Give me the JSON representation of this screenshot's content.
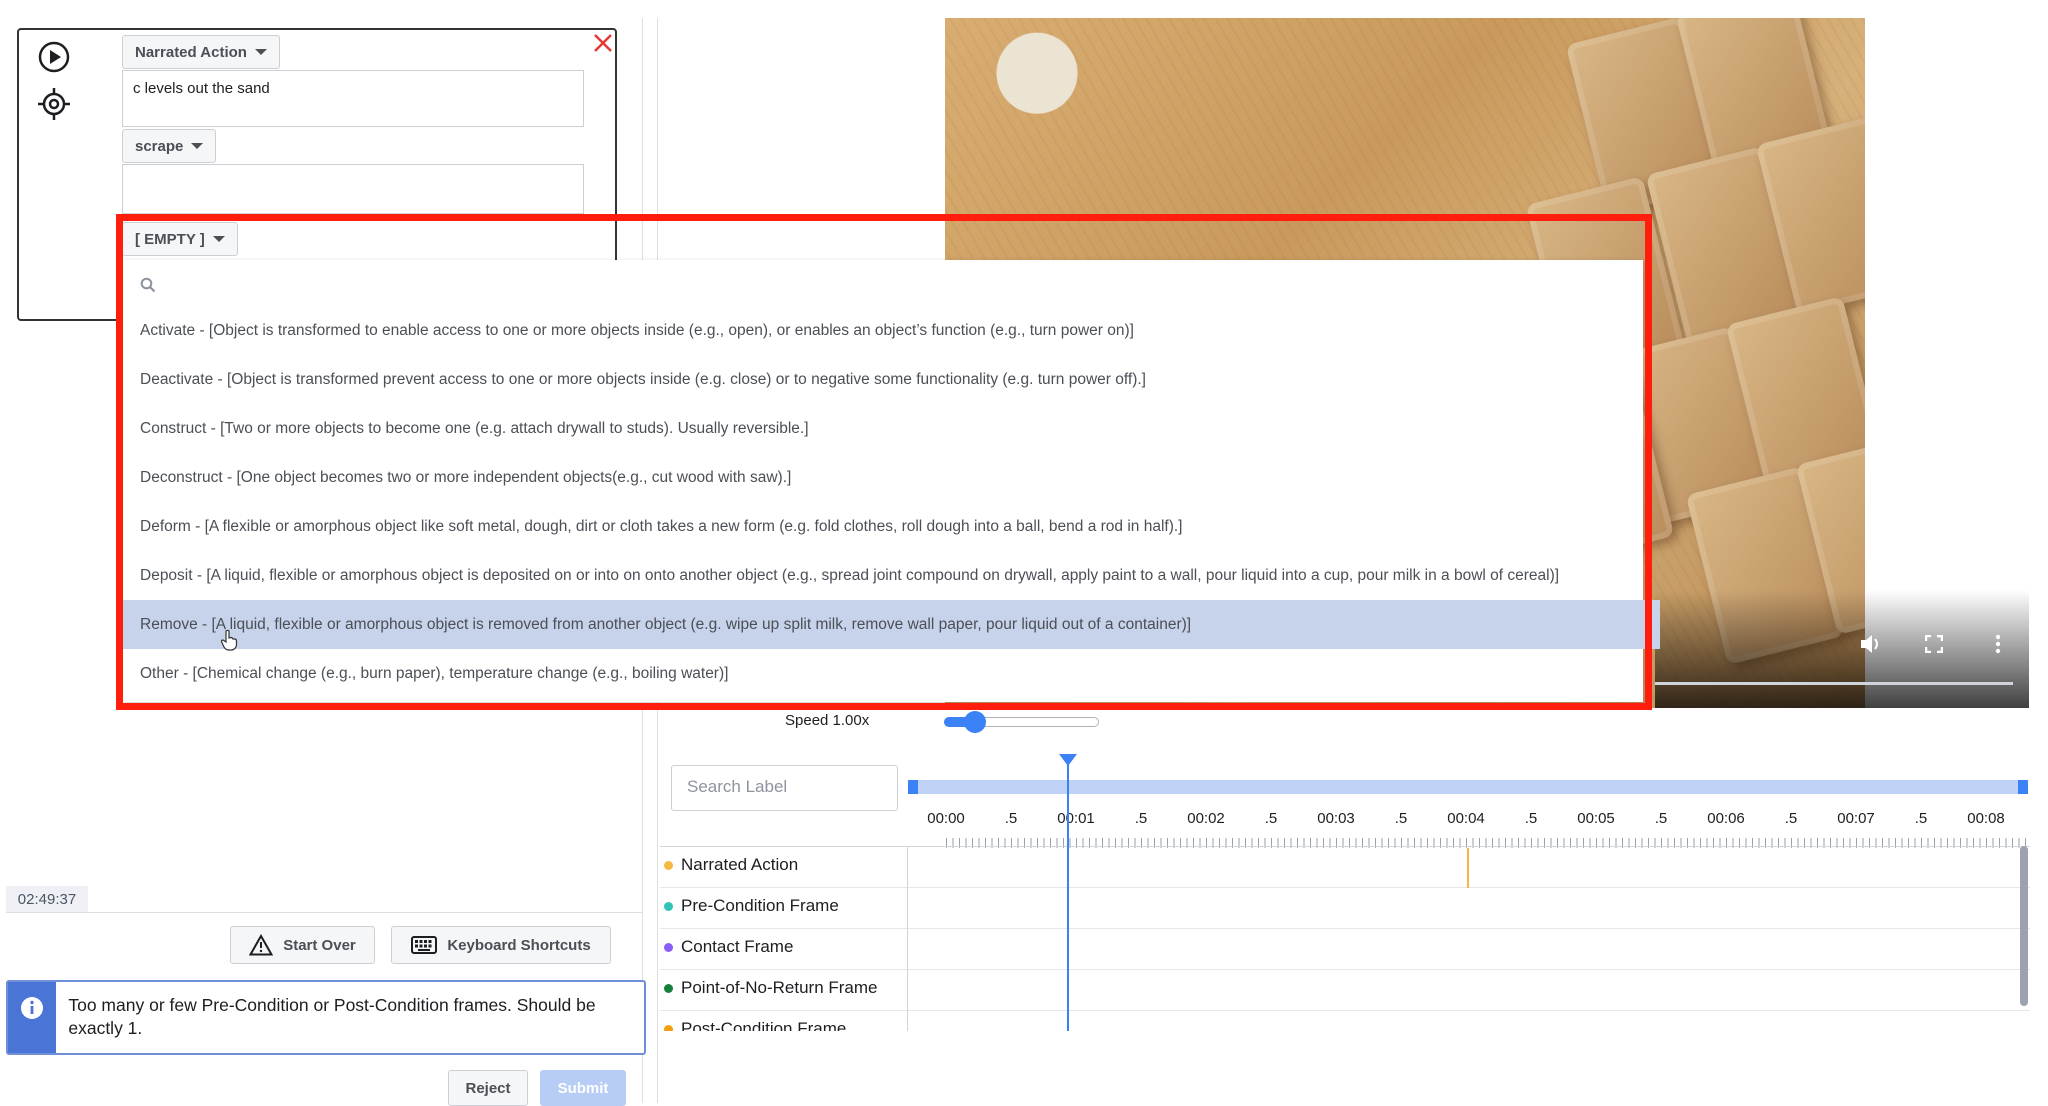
{
  "card": {
    "tag1": "Narrated Action",
    "text1": "c levels out the sand",
    "tag2": "scrape",
    "tag3": "[ EMPTY ]"
  },
  "dropdown": {
    "items": [
      "Activate - [Object is transformed to enable access to one or more objects inside (e.g., open), or enables an object’s function (e.g., turn power on)]",
      "Deactivate - [Object is transformed prevent access to one or more objects inside (e.g. close) or to negative some functionality (e.g. turn power off).]",
      "Construct - [Two or more objects to become one (e.g. attach drywall to studs). Usually reversible.]",
      "Deconstruct - [One object becomes two or more independent objects(e.g., cut wood with saw).]",
      "Deform - [A flexible or amorphous object like soft metal, dough, dirt or cloth takes a new form (e.g. fold clothes, roll dough into a ball, bend a rod in half).]",
      "Deposit - [A liquid, flexible or amorphous object is deposited on or into on onto another object (e.g., spread joint compound on drywall, apply paint to a wall, pour liquid into a cup, pour milk in a bowl of cereal)]",
      "Remove - [A liquid, flexible or amorphous object is removed from another object (e.g. wipe up split milk, remove wall paper, pour liquid out of a container)]",
      "Other - [Chemical change (e.g., burn paper), temperature change (e.g., boiling water)]"
    ],
    "selected_index": 6
  },
  "video": {
    "speed_label": "Speed 1.00x",
    "speed_value": 1.0
  },
  "footer": {
    "timestamp": "02:49:37",
    "start_over": "Start Over",
    "keyboard_shortcuts": "Keyboard Shortcuts",
    "notice": "Too many or few Pre-Condition or Post-Condition frames. Should be exactly 1.",
    "reject": "Reject",
    "submit": "Submit"
  },
  "timeline": {
    "search_placeholder": "Search Label",
    "ticks": [
      "00:00",
      ".5",
      "00:01",
      ".5",
      "00:02",
      ".5",
      "00:03",
      ".5",
      "00:04",
      ".5",
      "00:05",
      ".5",
      "00:06",
      ".5",
      "00:07",
      ".5",
      "00:08"
    ],
    "tracks": [
      {
        "name": "Narrated Action",
        "color": "#f5b942"
      },
      {
        "name": "Pre-Condition Frame",
        "color": "#2ec4b6"
      },
      {
        "name": "Contact Frame",
        "color": "#8b5cf6"
      },
      {
        "name": "Point-of-No-Return Frame",
        "color": "#15803d"
      },
      {
        "name": "Post-Condition Frame",
        "color": "#f59e0b"
      }
    ]
  }
}
